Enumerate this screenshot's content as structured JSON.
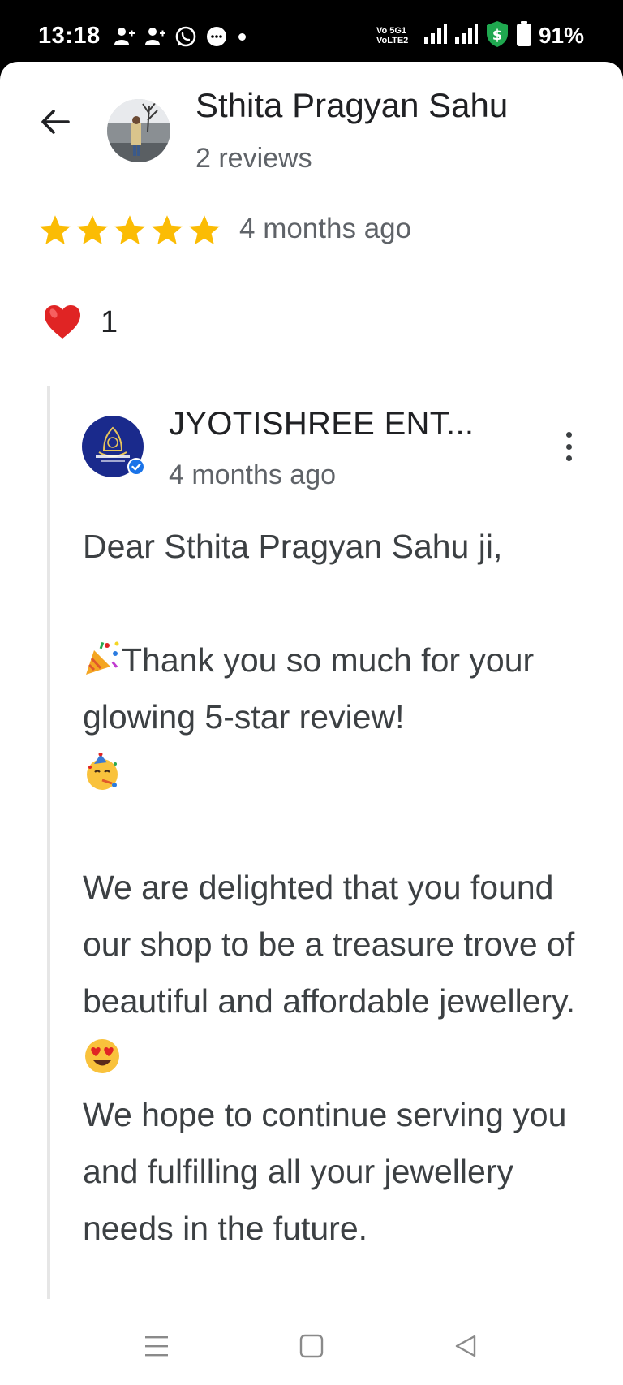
{
  "status_bar": {
    "time": "13:18",
    "network_top": "Vo 5G1",
    "network_bottom": "VoLTE2",
    "battery": "91%"
  },
  "review": {
    "reviewer_name": "Sthita Pragyan Sahu",
    "reviewer_meta": "2 reviews",
    "rating": 5,
    "time": "4 months ago",
    "like_count": "1"
  },
  "reply": {
    "owner_name": "JYOTISHREE ENT...",
    "time": "4 months ago",
    "greeting": "Dear Sthita Pragyan Sahu ji,",
    "thanks": "Thank you so much for your glowing 5-star review!",
    "body_1": "We are delighted that you found our shop to be a treasure trove of beautiful and affordable jewellery.",
    "body_2": "We hope to continue serving you and fulfilling all your jewellery needs in the future."
  },
  "colors": {
    "star": "#fbbc04",
    "text": "#202124",
    "secondary": "#5f6368",
    "verified": "#1a73e8"
  },
  "icons": {
    "back": "arrow-left-icon",
    "heart": "heart-icon",
    "more": "more-vert-icon",
    "nav_menu": "menu-icon",
    "nav_home": "square-icon",
    "nav_back": "triangle-back-icon"
  }
}
